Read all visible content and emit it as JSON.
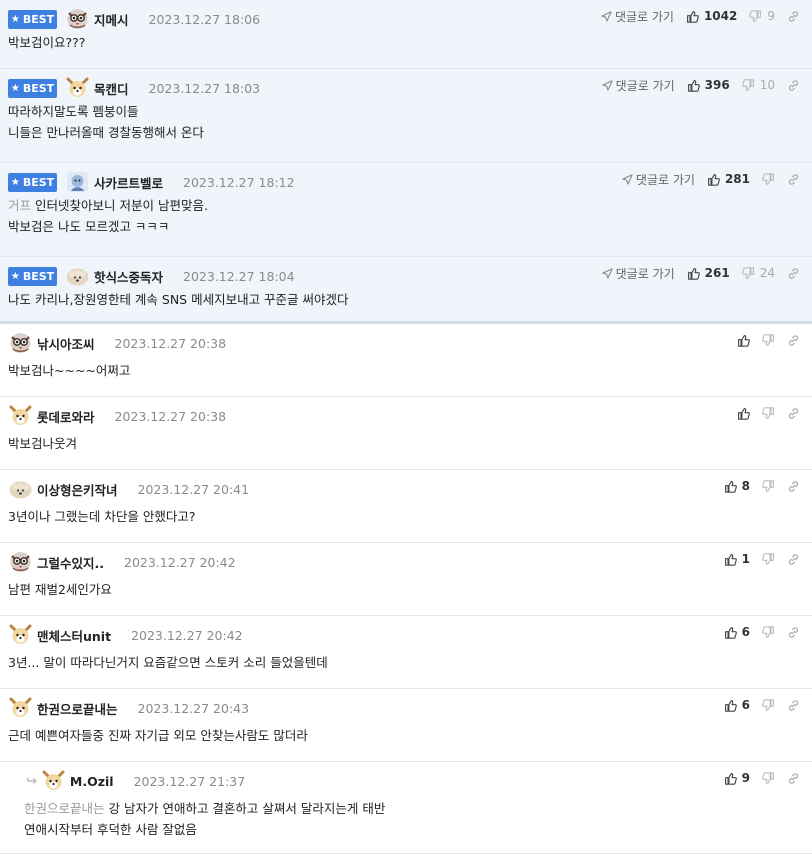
{
  "best_label": "BEST",
  "goto_reply_label": "댓글로 가기",
  "colors": {
    "best_bg": "#f0f4fb",
    "badge": "#3e7fe2"
  },
  "comments": [
    {
      "best": true,
      "avatar": "owl",
      "nick": "지메시",
      "date": "2023.12.27 18:06",
      "up": "1042",
      "down": "9",
      "lines": [
        "박보검이요???"
      ]
    },
    {
      "best": true,
      "avatar": "dog",
      "nick": "목캔디",
      "date": "2023.12.27 18:03",
      "up": "396",
      "down": "10",
      "lines": [
        "따라하지말도록 펨붕이들",
        "니들은 만나러올때 경찰동행해서 온다"
      ]
    },
    {
      "best": true,
      "avatar": "blue",
      "nick": "사카르트벨로",
      "date": "2023.12.27 18:12",
      "up": "281",
      "down": "",
      "mention": "거프",
      "lines": [
        "인터넷찾아보니 저분이 남편맞음.",
        "박보검은 나도 모르겠고 ㅋㅋㅋ"
      ]
    },
    {
      "best": true,
      "avatar": "sheep",
      "nick": "핫식스중독자",
      "date": "2023.12.27 18:04",
      "up": "261",
      "down": "24",
      "lines": [
        "나도 카리나,장원영한테 계속 SNS 메세지보내고 꾸준글 써야겠다"
      ]
    },
    {
      "best": false,
      "avatar": "owl",
      "nick": "낚시아조씨",
      "date": "2023.12.27 20:38",
      "up": "",
      "down": "",
      "lines": [
        "박보검나~~~~어쩌고"
      ]
    },
    {
      "best": false,
      "avatar": "dog",
      "nick": "롯데로와라",
      "date": "2023.12.27 20:38",
      "up": "",
      "down": "",
      "lines": [
        "박보검나웃겨"
      ]
    },
    {
      "best": false,
      "avatar": "sheep",
      "nick": "이상형은키작녀",
      "date": "2023.12.27 20:41",
      "up": "8",
      "down": "",
      "lines": [
        "3년이나 그랬는데 차단을 안했다고?"
      ]
    },
    {
      "best": false,
      "avatar": "owl",
      "nick": "그럴수있지..",
      "date": "2023.12.27 20:42",
      "up": "1",
      "down": "",
      "lines": [
        "남편 재벌2세인가요"
      ]
    },
    {
      "best": false,
      "avatar": "dog",
      "nick": "맨체스터unit",
      "date": "2023.12.27 20:42",
      "up": "6",
      "down": "",
      "lines": [
        "3년... 말이 따라다닌거지 요즘같으면 스토커 소리 들었을텐데"
      ]
    },
    {
      "best": false,
      "avatar": "dog",
      "nick": "한권으로끝내는",
      "date": "2023.12.27 20:43",
      "up": "6",
      "down": "",
      "lines": [
        "근데 예쁜여자들중 진짜 자기급 외모 안찾는사람도 많더라"
      ]
    },
    {
      "best": false,
      "reply": true,
      "avatar": "dog",
      "nick": "M.Ozil",
      "date": "2023.12.27 21:37",
      "up": "9",
      "down": "",
      "mention": "한권으로끝내는",
      "lines": [
        "강 남자가 연애하고 결혼하고 살쪄서 달라지는게 태반",
        "연애시작부터 후덕한 사람 잘없음"
      ]
    }
  ]
}
